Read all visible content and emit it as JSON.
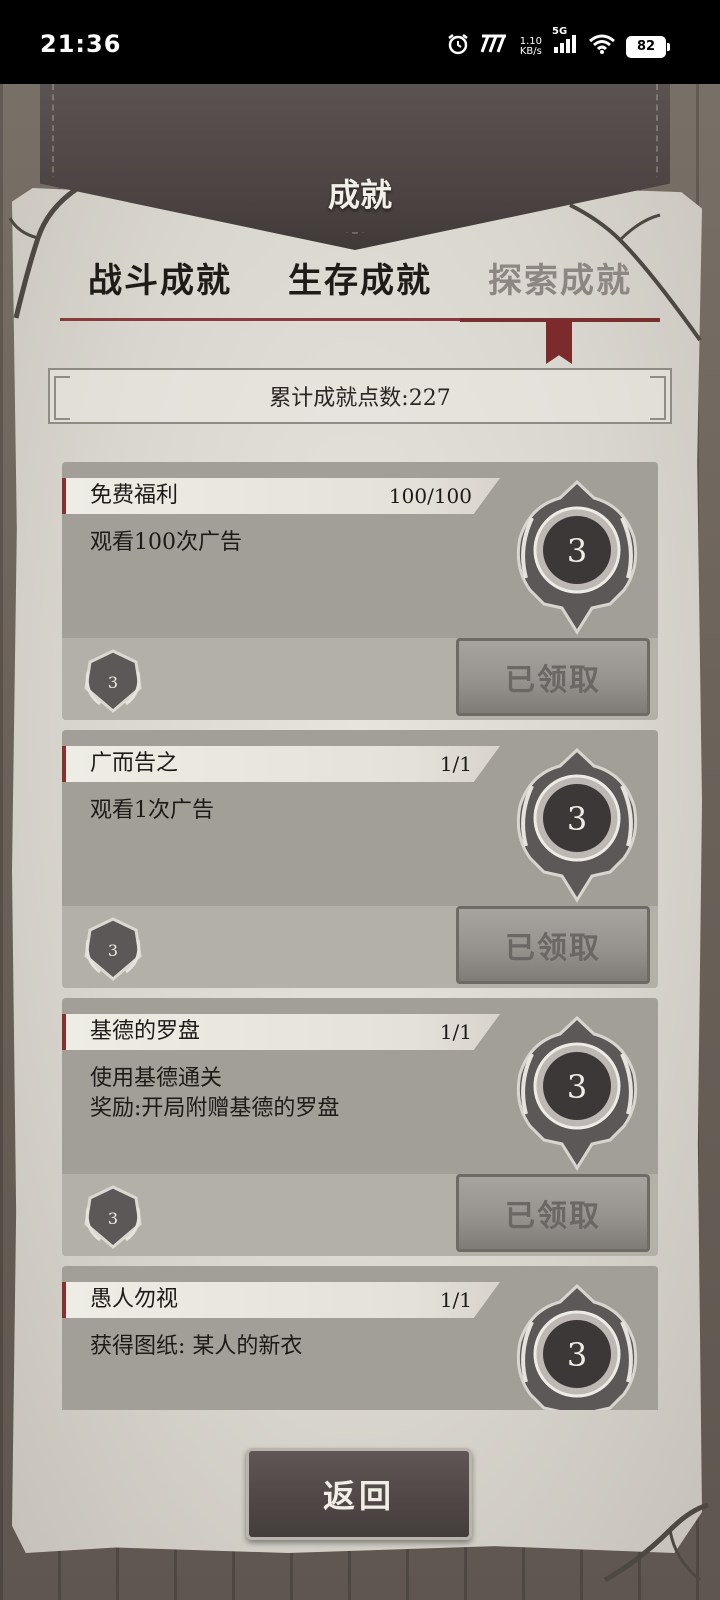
{
  "status_bar": {
    "time": "21:36",
    "net_speed_top": "1.10",
    "net_speed_bottom": "KB/s",
    "network": "5G",
    "battery": "82"
  },
  "header": {
    "title": "成就"
  },
  "tabs": [
    {
      "label": "战斗成就",
      "active": false
    },
    {
      "label": "生存成就",
      "active": false
    },
    {
      "label": "探索成就",
      "active": true
    }
  ],
  "points": {
    "label": "累计成就点数:227"
  },
  "achievements": [
    {
      "name": "免费福利",
      "progress": "100/100",
      "desc": [
        "观看100次广告"
      ],
      "medal_value": "3",
      "reward_value": "3",
      "button": "已领取"
    },
    {
      "name": "广而告之",
      "progress": "1/1",
      "desc": [
        "观看1次广告"
      ],
      "medal_value": "3",
      "reward_value": "3",
      "button": "已领取"
    },
    {
      "name": "基德的罗盘",
      "progress": "1/1",
      "desc": [
        "使用基德通关",
        "奖励:开局附赠基德的罗盘"
      ],
      "medal_value": "3",
      "reward_value": "3",
      "button": "已领取"
    },
    {
      "name": "愚人勿视",
      "progress": "1/1",
      "desc": [
        "获得图纸: 某人的新衣"
      ],
      "medal_value": "3",
      "reward_value": "",
      "button": ""
    }
  ],
  "footer": {
    "back_label": "返回"
  },
  "colors": {
    "accent_red": "#8a2f2f",
    "parchment": "#d9d6cf",
    "leather": "#4a4342"
  }
}
